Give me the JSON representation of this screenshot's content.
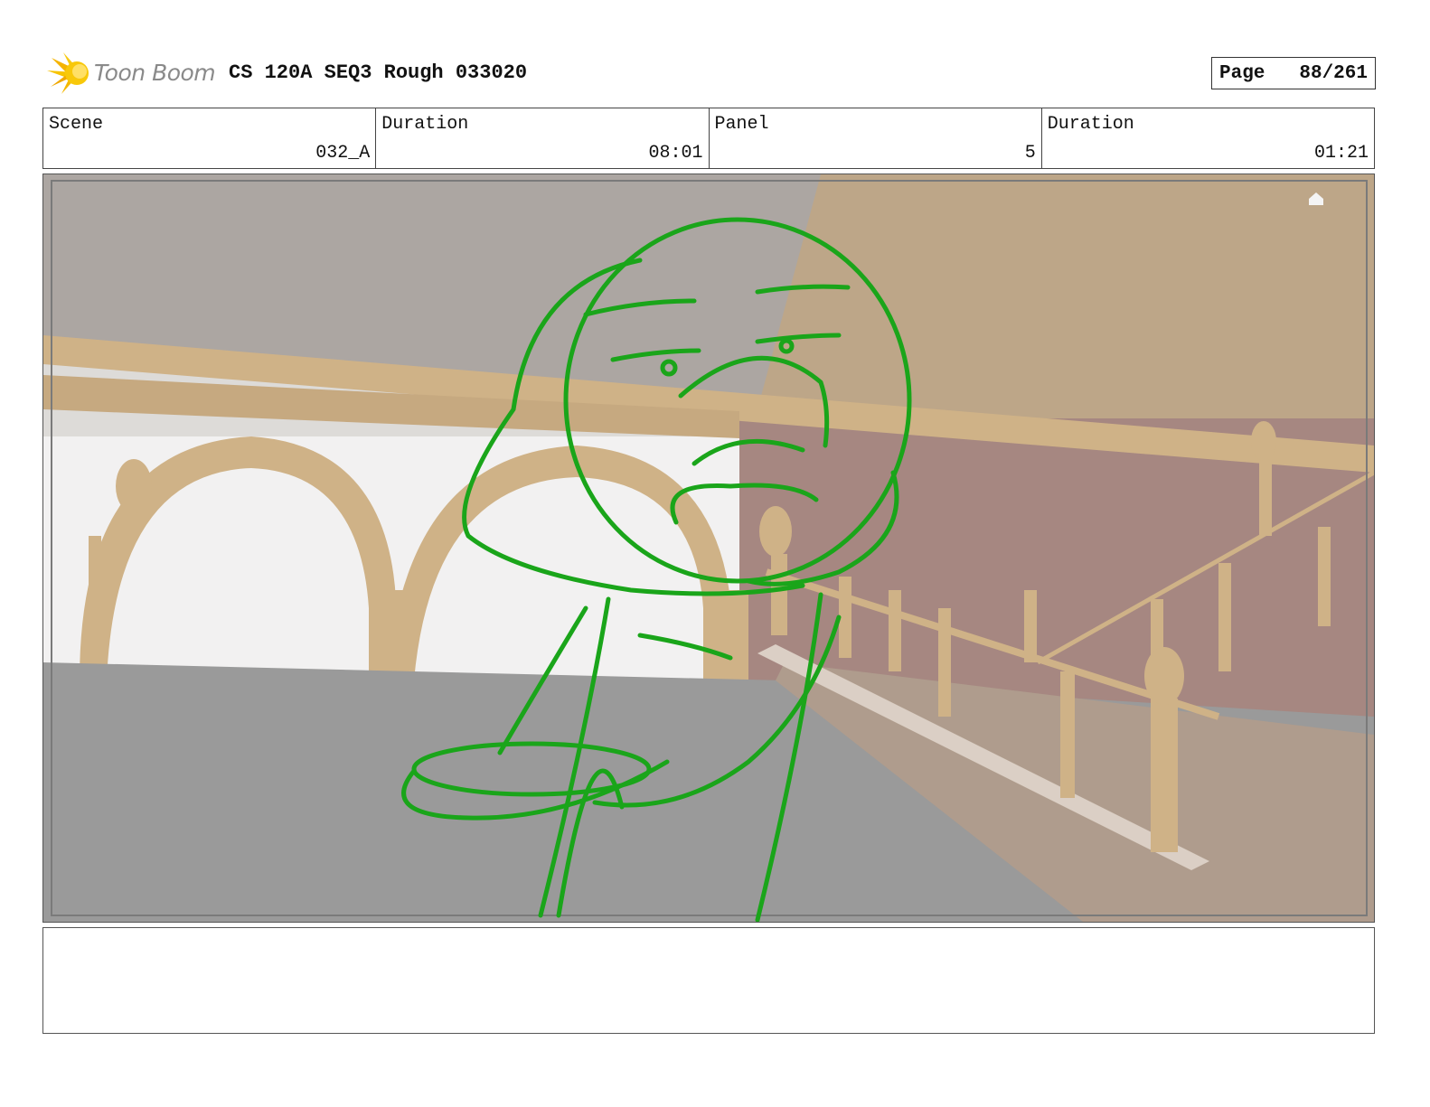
{
  "header": {
    "brand": "Toon Boom",
    "project_title": "CS 120A SEQ3 Rough 033020",
    "page_label": "Page",
    "page_value": "88/261"
  },
  "info": {
    "scene_label": "Scene",
    "scene_value": "032_A",
    "scene_duration_label": "Duration",
    "scene_duration_value": "08:01",
    "panel_label": "Panel",
    "panel_value": "5",
    "panel_duration_label": "Duration",
    "panel_duration_value": "01:21"
  },
  "colors": {
    "sketch": "#1aa51a",
    "wood": "#c9a877",
    "ceiling": "#a19a96",
    "wall_red": "#9a7770",
    "stairs": "#8c8c8c"
  },
  "notes": {
    "text": ""
  }
}
